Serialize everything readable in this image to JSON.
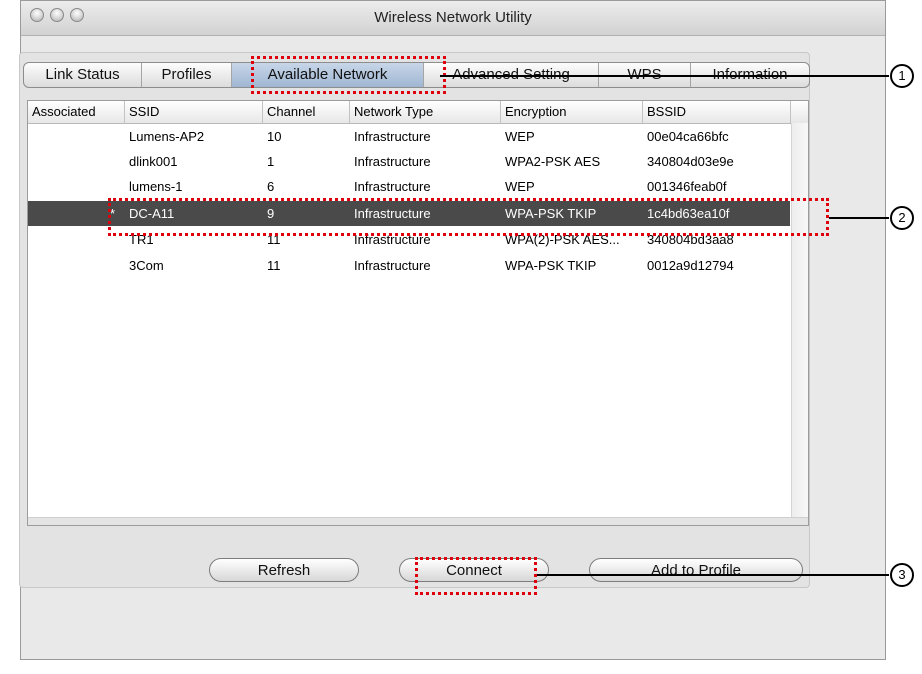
{
  "window": {
    "title": "Wireless Network Utility"
  },
  "tabs": [
    {
      "label": "Link Status"
    },
    {
      "label": "Profiles"
    },
    {
      "label": "Available Network"
    },
    {
      "label": "Advanced Setting"
    },
    {
      "label": "WPS"
    },
    {
      "label": "Information"
    }
  ],
  "table": {
    "columns": [
      "Associated",
      "SSID",
      "Channel",
      "Network Type",
      "Encryption",
      "BSSID"
    ],
    "rows": [
      {
        "associated": "",
        "ssid": "Lumens-AP2",
        "channel": "10",
        "type": "Infrastructure",
        "encryption": "WEP",
        "bssid": "00e04ca66bfc"
      },
      {
        "associated": "",
        "ssid": "dlink001",
        "channel": "1",
        "type": "Infrastructure",
        "encryption": "WPA2-PSK AES",
        "bssid": "340804d03e9e"
      },
      {
        "associated": "",
        "ssid": "lumens-1",
        "channel": "6",
        "type": "Infrastructure",
        "encryption": "WEP",
        "bssid": "001346feab0f"
      },
      {
        "associated": "*",
        "ssid": "DC-A11",
        "channel": "9",
        "type": "Infrastructure",
        "encryption": "WPA-PSK TKIP",
        "bssid": "1c4bd63ea10f"
      },
      {
        "associated": "",
        "ssid": "TR1",
        "channel": "11",
        "type": "Infrastructure",
        "encryption": "WPA(2)-PSK AES...",
        "bssid": "340804bd3aa8"
      },
      {
        "associated": "",
        "ssid": "3Com",
        "channel": "11",
        "type": "Infrastructure",
        "encryption": "WPA-PSK TKIP",
        "bssid": "0012a9d12794"
      }
    ],
    "selected_row": 3
  },
  "buttons": {
    "refresh": "Refresh",
    "connect": "Connect",
    "add_to_profile": "Add to Profile"
  },
  "callouts": [
    "1",
    "2",
    "3"
  ],
  "colors": {
    "callout_red": "#e0000b",
    "selected_row": "#4a4a4a"
  }
}
